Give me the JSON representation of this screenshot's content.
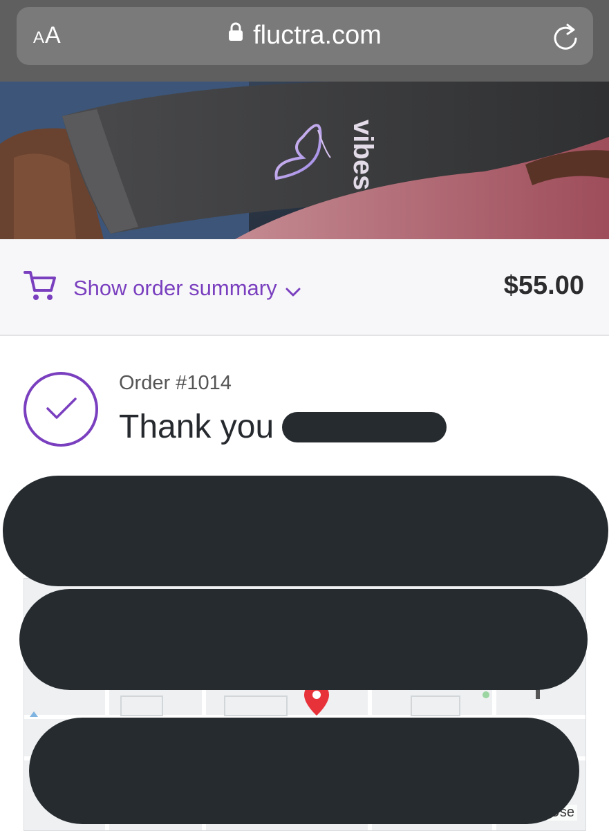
{
  "browser": {
    "text_size_label_big": "A",
    "text_size_label_small": "A",
    "url": "fluctra.com"
  },
  "hero": {
    "brand_text": "vibes"
  },
  "order_summary": {
    "toggle_label": "Show order summary",
    "total": "$55.00"
  },
  "confirmation": {
    "order_number": "Order #1014",
    "thank_you": "Thank you"
  },
  "map": {
    "terms_text": "Use"
  },
  "colors": {
    "accent": "#7a3fbf",
    "redaction": "#262b2f",
    "browser_bar": "#5f5f5f"
  }
}
